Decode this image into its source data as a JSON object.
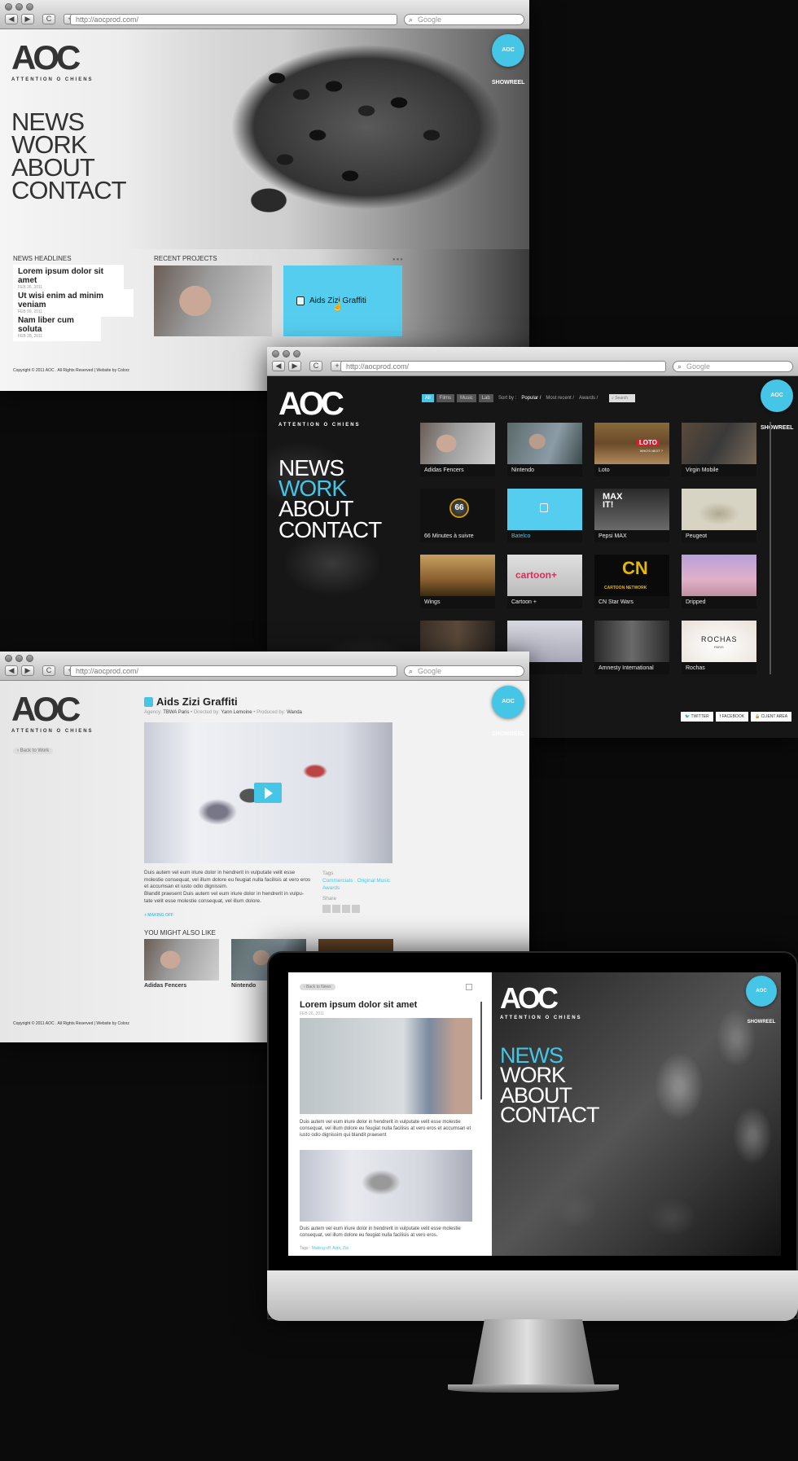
{
  "browser": {
    "url": "http://aocprod.com/",
    "search_placeholder": "Google",
    "back": "◀",
    "forward": "▶",
    "reload": "C",
    "add": "+"
  },
  "brand": {
    "logo": "AOC",
    "tagline": "ATTENTION O CHIENS",
    "sticker": "AOC SHOWREEL"
  },
  "menu": [
    "NEWS",
    "WORK",
    "ABOUT",
    "CONTACT"
  ],
  "home": {
    "news_heading": "NEWS HEADLINES",
    "news": [
      {
        "title": "Lorem ipsum dolor sit amet",
        "date": "FEB 26, 2011"
      },
      {
        "title": "Ut wisi enim ad minim veniam",
        "date": "FEB 09, 2011"
      },
      {
        "title": "Nam liber cum soluta",
        "date": "FEB 28, 2011"
      }
    ],
    "projects_heading": "RECENT PROJECTS",
    "featured": "Aids Zizi Graffiti",
    "footer": "Copyright © 2011 AOC . All Rights Reserved | Website by Colorz"
  },
  "work": {
    "filters": [
      "All",
      "Films",
      "Music",
      "Lab"
    ],
    "sort_label": "Sort by :",
    "sorts": [
      "Popular /",
      "Most recent /",
      "Awards /"
    ],
    "search": "Search",
    "items": [
      "Adidas Fencers",
      "Nintendo",
      "Loto",
      "Virgin Mobile",
      "66 Minutes à suivre",
      "Batelco",
      "Pepsi MAX",
      "Peugeot",
      "Wings",
      "Cartoon +",
      "CN Star Wars",
      "Dripped",
      "",
      "",
      "Amnesty International",
      "Rochas"
    ],
    "thumb_texts": {
      "loto": "LOTO",
      "loto_sub": "WHO'S NEXT ?",
      "sixsix": "66",
      "pepsi": "MAX IT!",
      "cartoon": "cartoon+",
      "cn": "CN",
      "cn_sub": "CARTOON NETWORK",
      "rochas": "ROCHAS",
      "rochas_sub": "PARIS"
    },
    "social": [
      "TWITTER",
      "FACEBOOK",
      "CLIENT AREA"
    ]
  },
  "project": {
    "title": "Aids Zizi Graffiti",
    "agency_label": "Agency:",
    "agency": "TBWA Paris",
    "director_label": "Directed by:",
    "director": "Yann Lemoine",
    "producer_label": "Produced by:",
    "producer": "Wanda",
    "back": "Back to Work",
    "description": "Duis autem vel eum iriure dolor in hendrerit in vulputate velit esse molestie consequat, vel illum dolore eu feugiat nulla facilisis at vero eros et accumsan et iusto odio dignissim.",
    "description2": "Blandit praesent Duis autem vel eum iriure dolor in hendrerit in vulpu-tate velit esse molestie consequat, vel illum dolore.",
    "tags_label": "Tags",
    "tags": "Commercials . Original Music",
    "tags2": "Awards",
    "share_label": "Share",
    "making_of": "+ MAKING OFF",
    "also_heading": "YOU MIGHT ALSO LIKE",
    "also": [
      "Adidas Fencers",
      "Nintendo",
      ""
    ],
    "footer": "Copyright © 2011 AOC . All Rights Reserved | Website by Colorz"
  },
  "imac": {
    "back": "Back to News",
    "title": "Lorem ipsum dolor sit amet",
    "date": "FEB 26, 2011",
    "para1": "Duis autem vel eum iriure dolor in hendrerit in vulputate velit esse molestie consequat, vel illum dolore eu feugiat nulla facilisis at vero eros et accumsan et iusto odio dignissim qui blandit praesent",
    "para2": "Duis autem vel eum iriure dolor in hendrerit in vulputate velit esse molestie consequat, vel illum dolore eu feugiat nulla facilisis at vero eros.",
    "tags_label": "Tags :",
    "tags": "Making off, Aids, Zizi"
  },
  "colors": {
    "accent": "#45c6e6",
    "dark_bg": "#1b1b1b",
    "light_bg": "#eeeeee"
  }
}
